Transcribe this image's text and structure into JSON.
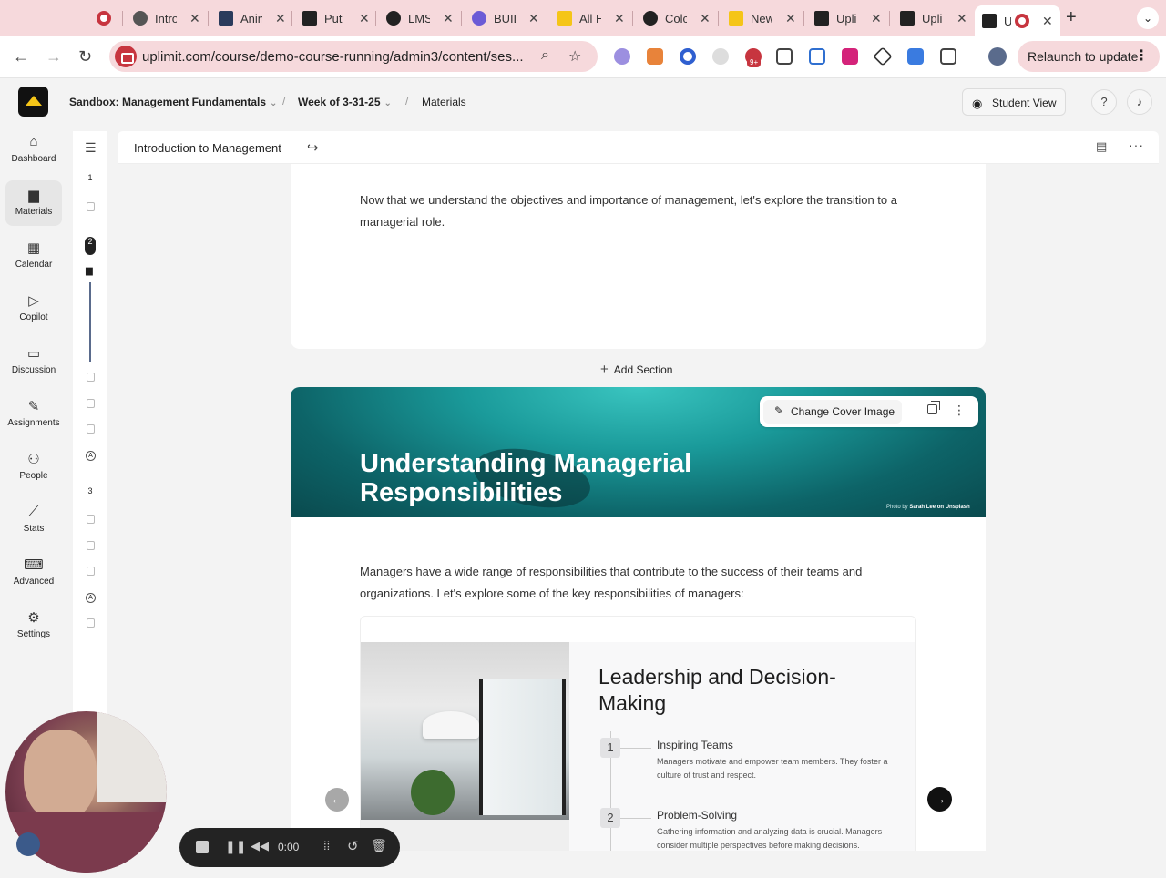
{
  "browser": {
    "tabs": [
      {
        "title": "",
        "fav": "#c7353f"
      },
      {
        "title": "Intro",
        "fav": "#555"
      },
      {
        "title": "Anin",
        "fav": "#2a3b5c"
      },
      {
        "title": "Put",
        "fav": "#222"
      },
      {
        "title": "LMS",
        "fav": "#222"
      },
      {
        "title": "BUIL",
        "fav": "#6b5bd6"
      },
      {
        "title": "All H",
        "fav": "#f5c518"
      },
      {
        "title": "Colc",
        "fav": "#222"
      },
      {
        "title": "New",
        "fav": "#f5c518"
      },
      {
        "title": "Upli",
        "fav": "#222"
      },
      {
        "title": "Upli",
        "fav": "#222"
      },
      {
        "title": "U",
        "fav": "#222"
      }
    ],
    "new_tab": "+",
    "url": "uplimit.com/course/demo-course-running/admin3/content/ses...",
    "relaunch_label": "Relaunch to update",
    "badge": "9+"
  },
  "header": {
    "course": "Sandbox: Management Fundamentals",
    "week": "Week of 3-31-25",
    "section": "Materials",
    "student_view": "Student View",
    "help": "?"
  },
  "nav": [
    {
      "label": "Dashboard",
      "icon": "rocket-icon"
    },
    {
      "label": "Materials",
      "icon": "book-icon"
    },
    {
      "label": "Calendar",
      "icon": "calendar-icon"
    },
    {
      "label": "Copilot",
      "icon": "copilot-icon"
    },
    {
      "label": "Discussion",
      "icon": "chat-icon"
    },
    {
      "label": "Assignments",
      "icon": "pencil-icon"
    },
    {
      "label": "People",
      "icon": "people-icon"
    },
    {
      "label": "Stats",
      "icon": "chart-icon"
    },
    {
      "label": "Advanced",
      "icon": "keyboard-icon"
    },
    {
      "label": "Settings",
      "icon": "gear-icon"
    }
  ],
  "outline": {
    "numbers": [
      "1",
      "2",
      "3"
    ]
  },
  "page": {
    "title": "Introduction to Management",
    "intro_text": "Now that we understand the objectives and importance of management, let's explore the transition to a managerial role.",
    "add_section": "Add Section",
    "cover_title": "Understanding Managerial Responsibilities",
    "change_cover": "Change Cover Image",
    "photo_credit_prefix": "Photo by",
    "photo_credit_author": "Sarah Lee",
    "photo_credit_suffix": "on Unsplash",
    "body_text": "Managers have a wide range of responsibilities that contribute to the success of their teams and organizations. Let's explore some of the key responsibilities of managers:",
    "slide": {
      "title": "Leadership and Decision-Making",
      "steps": [
        {
          "num": "1",
          "title": "Inspiring Teams",
          "desc": "Managers motivate and empower team members. They foster a culture of trust and respect."
        },
        {
          "num": "2",
          "title": "Problem-Solving",
          "desc": "Gathering information and analyzing data is crucial. Managers consider multiple perspectives before making decisions."
        }
      ]
    }
  },
  "recorder": {
    "time": "0:00"
  }
}
